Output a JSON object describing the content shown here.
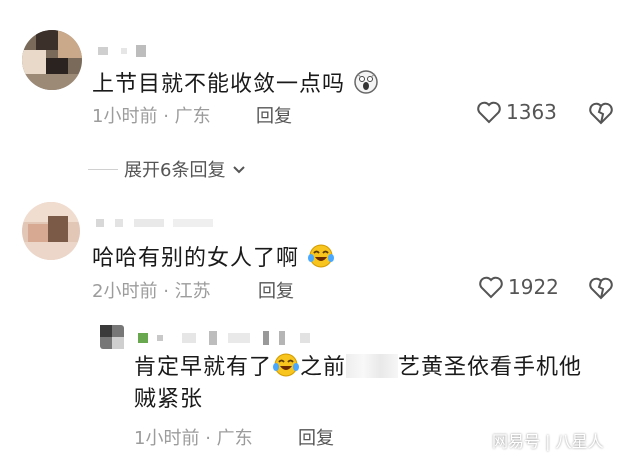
{
  "comments": [
    {
      "text": "上节目就不能收敛一点吗",
      "time": "1小时前",
      "location": "广东",
      "reply_label": "回复",
      "likes": "1363",
      "expand_label": "展开6条回复"
    },
    {
      "text": "哈哈有别的女人了啊",
      "time": "2小时前",
      "location": "江苏",
      "reply_label": "回复",
      "likes": "1922"
    }
  ],
  "reply": {
    "text_part1": "肯定早就有了",
    "text_part2": "之前",
    "text_part3": "艺黄圣依看手机他",
    "text_line2": "贼紧张",
    "time": "1小时前",
    "location": "广东",
    "reply_label": "回复"
  },
  "meta_separator": "·",
  "icons": {
    "heart": "heart-outline-icon",
    "dislike": "broken-heart-icon",
    "chevron": "chevron-down-icon",
    "emoji_shocked": "shocked-face-emoji",
    "emoji_laugh": "tears-of-joy-emoji"
  },
  "watermark": {
    "left": "网易号",
    "divider": "|",
    "right": "八星人"
  }
}
